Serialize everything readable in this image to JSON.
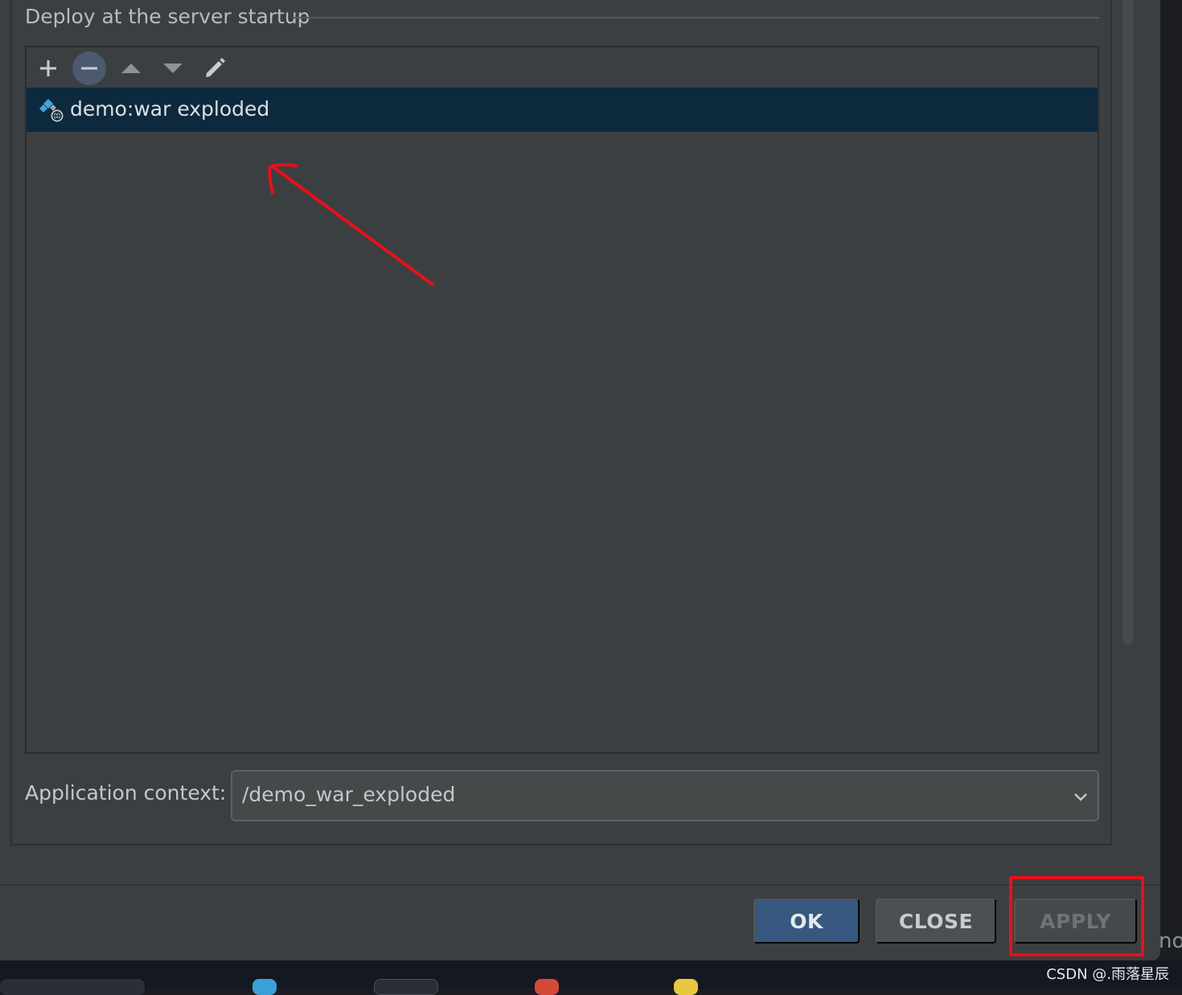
{
  "group": {
    "title": "Deploy at the server startup"
  },
  "toolbar": {
    "add_icon": "plus-icon",
    "remove_icon": "minus-icon",
    "up_icon": "triangle-up-icon",
    "down_icon": "triangle-down-icon",
    "edit_icon": "pencil-icon"
  },
  "artifacts": [
    {
      "label": "demo:war exploded",
      "icon": "web-artifact-icon",
      "selected": true
    }
  ],
  "context": {
    "label": "Application context:",
    "value": "/demo_war_exploded"
  },
  "buttons": {
    "ok": "OK",
    "close": "CLOSE",
    "apply": "APPLY"
  },
  "background": {
    "side_text": "no"
  },
  "watermark": "CSDN @.雨落星辰",
  "colors": {
    "accent": "#365880",
    "selection": "#0d293e",
    "annotation": "#e8101a"
  }
}
